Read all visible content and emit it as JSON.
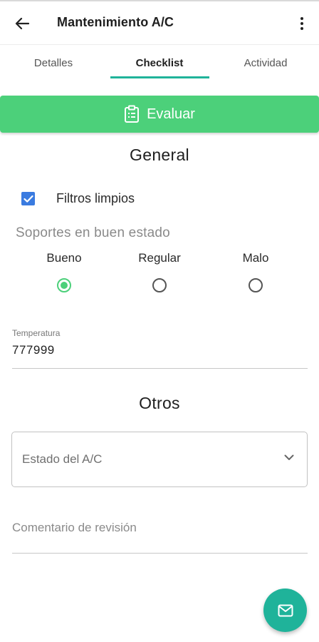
{
  "appbar": {
    "title": "Mantenimiento A/C",
    "back_icon": "arrow-left-icon",
    "menu_icon": "more-vertical-icon"
  },
  "tabs": [
    {
      "label": "Detalles",
      "active": false
    },
    {
      "label": "Checklist",
      "active": true
    },
    {
      "label": "Actividad",
      "active": false
    }
  ],
  "evaluate_button": {
    "label": "Evaluar",
    "icon": "clipboard-icon",
    "color": "#4cd07a"
  },
  "sections": {
    "general": "General",
    "otros": "Otros"
  },
  "checklist": {
    "checkbox_item": {
      "label": "Filtros limpios",
      "checked": true
    },
    "radio_question": "Soportes en buen estado",
    "radio_options": [
      {
        "label": "Bueno",
        "selected": true
      },
      {
        "label": "Regular",
        "selected": false
      },
      {
        "label": "Malo",
        "selected": false
      }
    ],
    "temperature": {
      "label": "Temperatura",
      "value": "777999"
    }
  },
  "otros": {
    "select": {
      "placeholder": "Estado del A/C",
      "icon": "chevron-down-icon"
    },
    "comment": {
      "placeholder": "Comentario de revisión"
    }
  },
  "fab": {
    "icon": "mail-icon",
    "color": "#1fb39a"
  },
  "colors": {
    "accent": "#1fb39a",
    "success": "#4cd07a",
    "checkbox": "#3a7be0"
  }
}
